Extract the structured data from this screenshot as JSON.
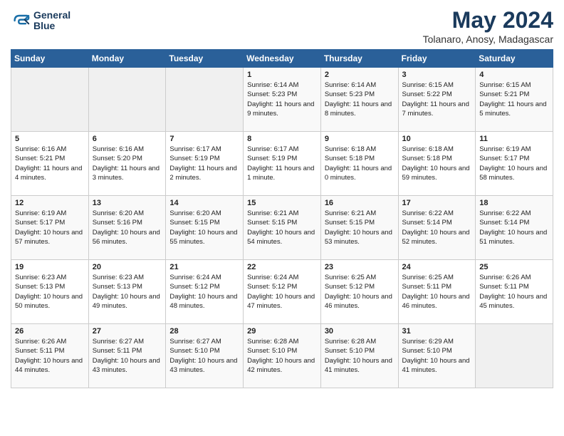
{
  "logo": {
    "text_line1": "General",
    "text_line2": "Blue"
  },
  "title": "May 2024",
  "subtitle": "Tolanaro, Anosy, Madagascar",
  "headers": [
    "Sunday",
    "Monday",
    "Tuesday",
    "Wednesday",
    "Thursday",
    "Friday",
    "Saturday"
  ],
  "weeks": [
    [
      {
        "day": "",
        "info": ""
      },
      {
        "day": "",
        "info": ""
      },
      {
        "day": "",
        "info": ""
      },
      {
        "day": "1",
        "info": "Sunrise: 6:14 AM\nSunset: 5:23 PM\nDaylight: 11 hours\nand 9 minutes."
      },
      {
        "day": "2",
        "info": "Sunrise: 6:14 AM\nSunset: 5:23 PM\nDaylight: 11 hours\nand 8 minutes."
      },
      {
        "day": "3",
        "info": "Sunrise: 6:15 AM\nSunset: 5:22 PM\nDaylight: 11 hours\nand 7 minutes."
      },
      {
        "day": "4",
        "info": "Sunrise: 6:15 AM\nSunset: 5:21 PM\nDaylight: 11 hours\nand 5 minutes."
      }
    ],
    [
      {
        "day": "5",
        "info": "Sunrise: 6:16 AM\nSunset: 5:21 PM\nDaylight: 11 hours\nand 4 minutes."
      },
      {
        "day": "6",
        "info": "Sunrise: 6:16 AM\nSunset: 5:20 PM\nDaylight: 11 hours\nand 3 minutes."
      },
      {
        "day": "7",
        "info": "Sunrise: 6:17 AM\nSunset: 5:19 PM\nDaylight: 11 hours\nand 2 minutes."
      },
      {
        "day": "8",
        "info": "Sunrise: 6:17 AM\nSunset: 5:19 PM\nDaylight: 11 hours\nand 1 minute."
      },
      {
        "day": "9",
        "info": "Sunrise: 6:18 AM\nSunset: 5:18 PM\nDaylight: 11 hours\nand 0 minutes."
      },
      {
        "day": "10",
        "info": "Sunrise: 6:18 AM\nSunset: 5:18 PM\nDaylight: 10 hours\nand 59 minutes."
      },
      {
        "day": "11",
        "info": "Sunrise: 6:19 AM\nSunset: 5:17 PM\nDaylight: 10 hours\nand 58 minutes."
      }
    ],
    [
      {
        "day": "12",
        "info": "Sunrise: 6:19 AM\nSunset: 5:17 PM\nDaylight: 10 hours\nand 57 minutes."
      },
      {
        "day": "13",
        "info": "Sunrise: 6:20 AM\nSunset: 5:16 PM\nDaylight: 10 hours\nand 56 minutes."
      },
      {
        "day": "14",
        "info": "Sunrise: 6:20 AM\nSunset: 5:15 PM\nDaylight: 10 hours\nand 55 minutes."
      },
      {
        "day": "15",
        "info": "Sunrise: 6:21 AM\nSunset: 5:15 PM\nDaylight: 10 hours\nand 54 minutes."
      },
      {
        "day": "16",
        "info": "Sunrise: 6:21 AM\nSunset: 5:15 PM\nDaylight: 10 hours\nand 53 minutes."
      },
      {
        "day": "17",
        "info": "Sunrise: 6:22 AM\nSunset: 5:14 PM\nDaylight: 10 hours\nand 52 minutes."
      },
      {
        "day": "18",
        "info": "Sunrise: 6:22 AM\nSunset: 5:14 PM\nDaylight: 10 hours\nand 51 minutes."
      }
    ],
    [
      {
        "day": "19",
        "info": "Sunrise: 6:23 AM\nSunset: 5:13 PM\nDaylight: 10 hours\nand 50 minutes."
      },
      {
        "day": "20",
        "info": "Sunrise: 6:23 AM\nSunset: 5:13 PM\nDaylight: 10 hours\nand 49 minutes."
      },
      {
        "day": "21",
        "info": "Sunrise: 6:24 AM\nSunset: 5:12 PM\nDaylight: 10 hours\nand 48 minutes."
      },
      {
        "day": "22",
        "info": "Sunrise: 6:24 AM\nSunset: 5:12 PM\nDaylight: 10 hours\nand 47 minutes."
      },
      {
        "day": "23",
        "info": "Sunrise: 6:25 AM\nSunset: 5:12 PM\nDaylight: 10 hours\nand 46 minutes."
      },
      {
        "day": "24",
        "info": "Sunrise: 6:25 AM\nSunset: 5:11 PM\nDaylight: 10 hours\nand 46 minutes."
      },
      {
        "day": "25",
        "info": "Sunrise: 6:26 AM\nSunset: 5:11 PM\nDaylight: 10 hours\nand 45 minutes."
      }
    ],
    [
      {
        "day": "26",
        "info": "Sunrise: 6:26 AM\nSunset: 5:11 PM\nDaylight: 10 hours\nand 44 minutes."
      },
      {
        "day": "27",
        "info": "Sunrise: 6:27 AM\nSunset: 5:11 PM\nDaylight: 10 hours\nand 43 minutes."
      },
      {
        "day": "28",
        "info": "Sunrise: 6:27 AM\nSunset: 5:10 PM\nDaylight: 10 hours\nand 43 minutes."
      },
      {
        "day": "29",
        "info": "Sunrise: 6:28 AM\nSunset: 5:10 PM\nDaylight: 10 hours\nand 42 minutes."
      },
      {
        "day": "30",
        "info": "Sunrise: 6:28 AM\nSunset: 5:10 PM\nDaylight: 10 hours\nand 41 minutes."
      },
      {
        "day": "31",
        "info": "Sunrise: 6:29 AM\nSunset: 5:10 PM\nDaylight: 10 hours\nand 41 minutes."
      },
      {
        "day": "",
        "info": ""
      }
    ]
  ]
}
